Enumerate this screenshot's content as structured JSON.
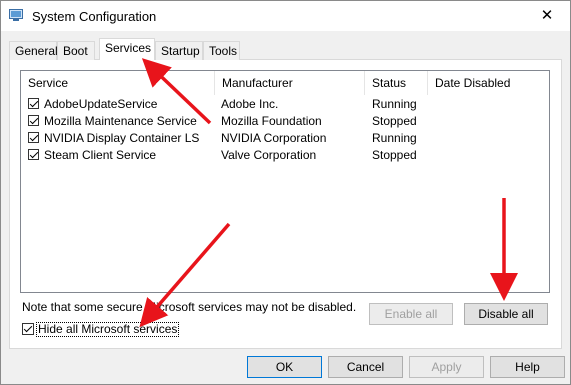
{
  "window": {
    "title": "System Configuration",
    "close_label": "✕"
  },
  "tabs": [
    "General",
    "Boot",
    "Services",
    "Startup",
    "Tools"
  ],
  "active_tab": "Services",
  "columns": [
    "Service",
    "Manufacturer",
    "Status",
    "Date Disabled"
  ],
  "services": [
    {
      "name": "AdobeUpdateService",
      "manufacturer": "Adobe Inc.",
      "status": "Running",
      "date_disabled": ""
    },
    {
      "name": "Mozilla Maintenance Service",
      "manufacturer": "Mozilla Foundation",
      "status": "Stopped",
      "date_disabled": ""
    },
    {
      "name": "NVIDIA Display Container LS",
      "manufacturer": "NVIDIA Corporation",
      "status": "Running",
      "date_disabled": ""
    },
    {
      "name": "Steam Client Service",
      "manufacturer": "Valve Corporation",
      "status": "Stopped",
      "date_disabled": ""
    }
  ],
  "note": "Note that some secure Microsoft services may not be disabled.",
  "buttons": {
    "enable_all": "Enable all",
    "disable_all": "Disable all",
    "ok": "OK",
    "cancel": "Cancel",
    "apply": "Apply",
    "help": "Help"
  },
  "hide_microsoft": {
    "label": "Hide all Microsoft services",
    "checked": true
  },
  "colors": {
    "arrow": "#e8141b",
    "focus_border": "#0078d7"
  }
}
